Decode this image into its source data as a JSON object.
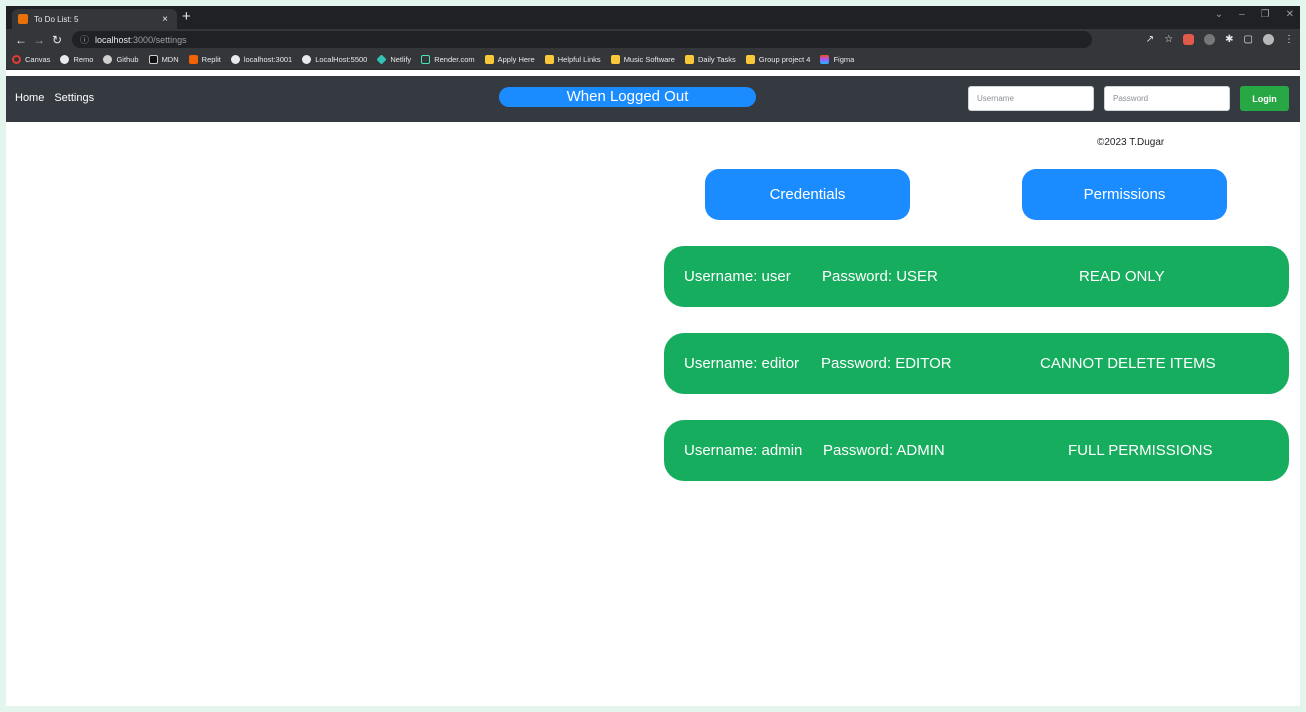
{
  "browser": {
    "tab_title": "To Do List: 5",
    "tab_close": "×",
    "new_tab": "+",
    "url_host": "localhost",
    "url_path": ":3000/settings",
    "bookmarks": [
      "Canvas",
      "Remo",
      "Github",
      "MDN",
      "Replit",
      "localhost:3001",
      "LocalHost:5500",
      "Netlify",
      "Render.com",
      "Apply Here",
      "Helpful Links",
      "Music Software",
      "Daily Tasks",
      "Group project 4",
      "Figma"
    ]
  },
  "nav": {
    "home": "Home",
    "settings": "Settings",
    "status_pill": "When Logged Out",
    "username_placeholder": "Username",
    "password_placeholder": "Password",
    "login": "Login"
  },
  "page": {
    "copyright": "©2023 T.Dugar",
    "credentials_heading": "Credentials",
    "permissions_heading": "Permissions",
    "rows": [
      {
        "username": "Username:  user",
        "password": "Password: USER",
        "permission": "READ ONLY"
      },
      {
        "username": "Username:  editor",
        "password": "Password: EDITOR",
        "permission": "CANNOT DELETE ITEMS"
      },
      {
        "username": "Username: admin",
        "password": "Password: ADMIN",
        "permission": "FULL PERMISSIONS"
      }
    ]
  },
  "colors": {
    "navbar": "#343a40",
    "accent_blue": "#1a8cff",
    "row_green": "#17ad5e",
    "login_green": "#28a745"
  }
}
